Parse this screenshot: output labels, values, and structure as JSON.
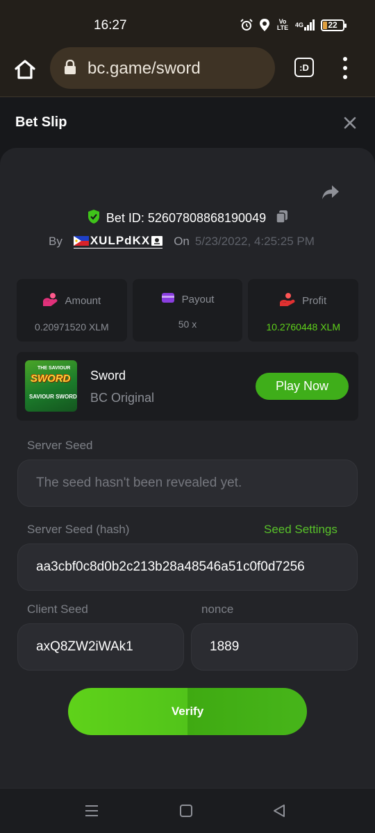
{
  "status_bar": {
    "time": "16:27",
    "icons": [
      "alarm-icon",
      "location-icon",
      "volte-icon",
      "signal-4g-icon"
    ],
    "volte_text": "Vo LTE",
    "network": "4G",
    "battery": "22"
  },
  "browser": {
    "url": "bc.game/sword",
    "tab_label": ":D"
  },
  "header": {
    "title": "Bet Slip"
  },
  "bet": {
    "id_label": "Bet ID: 52607808868190049",
    "by_label": "By",
    "username": "XULPdKX",
    "on_label": "On",
    "date": "5/23/2022, 4:25:25 PM"
  },
  "stats": [
    {
      "label": "Amount",
      "value": "0.20971520 XLM",
      "icon": "amount-icon",
      "color": "#e0317a"
    },
    {
      "label": "Payout",
      "value": "50 x",
      "icon": "payout-icon",
      "color": "#8a3ee0"
    },
    {
      "label": "Profit",
      "value": "10.2760448 XLM",
      "icon": "profit-icon",
      "color": "#e03131"
    }
  ],
  "game": {
    "name": "Sword",
    "provider": "BC Original",
    "play_label": "Play Now",
    "thumb_title": "SWORD",
    "thumb_top": "THE SAVIOUR",
    "thumb_bottom": "SAVIOUR SWORD"
  },
  "fairness": {
    "server_seed_label": "Server Seed",
    "server_seed_value": "The seed hasn't been revealed yet.",
    "server_seed_hash_label": "Server Seed (hash)",
    "seed_settings_label": "Seed Settings",
    "server_seed_hash_value": "aa3cbf0c8d0b2c213b28a48546a51c0f0d7256",
    "client_seed_label": "Client Seed",
    "client_seed_value": "axQ8ZW2iWAk1",
    "nonce_label": "nonce",
    "nonce_value": "1889"
  },
  "verify_label": "Verify",
  "colors": {
    "accent_green": "#5fd21a",
    "profit_green": "#5fd21a",
    "background": "#17181b",
    "card": "#232428"
  }
}
